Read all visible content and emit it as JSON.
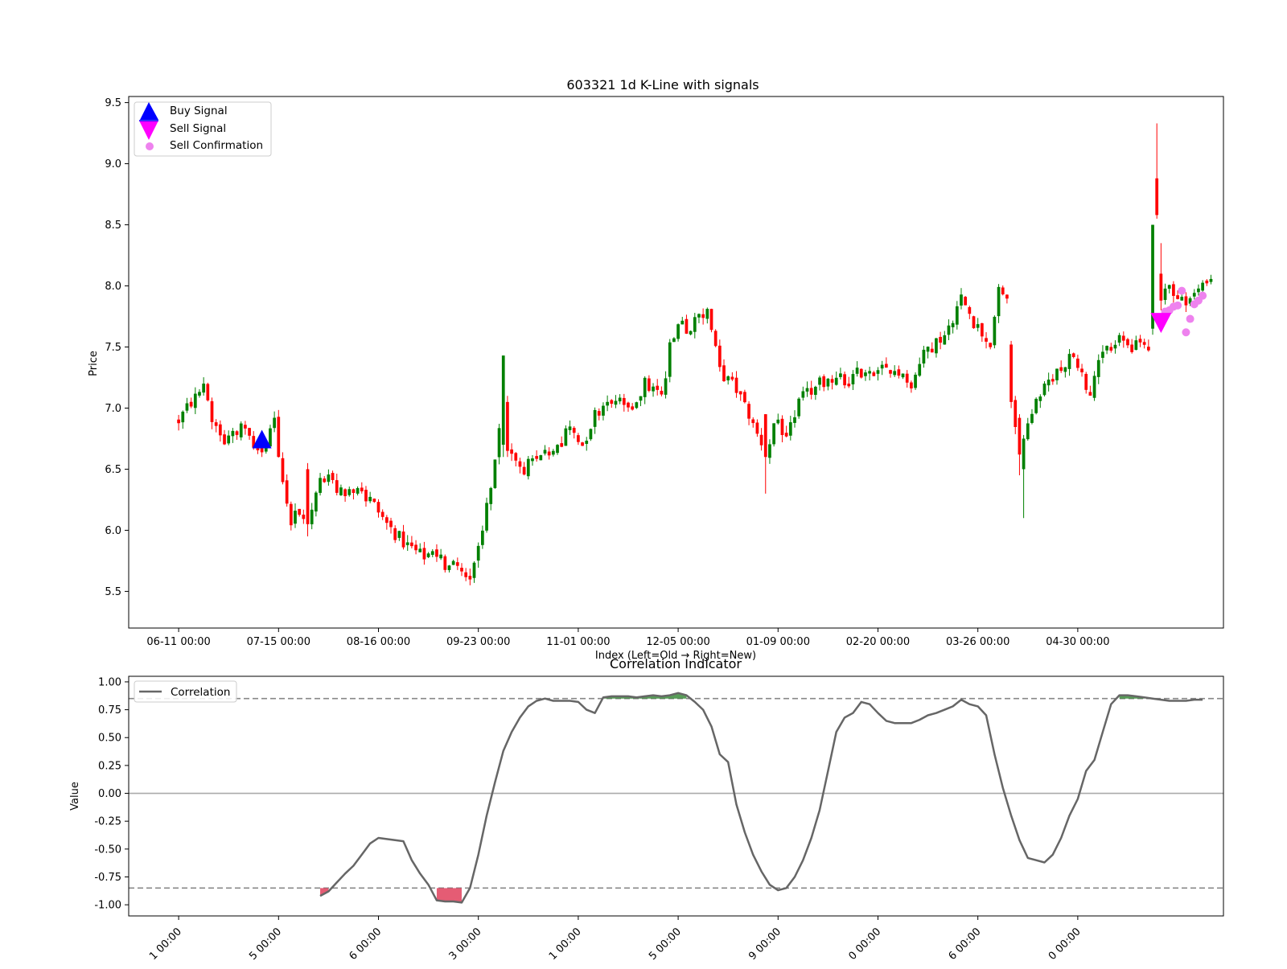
{
  "figure": {
    "background": "#ffffff"
  },
  "chart_data": [
    {
      "type": "candlestick",
      "title": "603321 1d K-Line with signals",
      "xlabel": "Index (Left=Old → Right=New)",
      "ylabel": "Price",
      "ylim": [
        5.2,
        9.55
      ],
      "yticks": [
        "5.5",
        "6.0",
        "6.5",
        "7.0",
        "7.5",
        "8.0",
        "8.5",
        "9.0",
        "9.5"
      ],
      "xticks": [
        {
          "index": 0,
          "label": "06-11 00:00"
        },
        {
          "index": 24,
          "label": "07-15 00:00"
        },
        {
          "index": 48,
          "label": "08-16 00:00"
        },
        {
          "index": 72,
          "label": "09-23 00:00"
        },
        {
          "index": 96,
          "label": "11-01 00:00"
        },
        {
          "index": 120,
          "label": "12-05 00:00"
        },
        {
          "index": 144,
          "label": "01-09 00:00"
        },
        {
          "index": 168,
          "label": "02-20 00:00"
        },
        {
          "index": 192,
          "label": "03-26 00:00"
        },
        {
          "index": 216,
          "label": "04-30 00:00"
        }
      ],
      "x_range": [
        -12,
        251
      ],
      "colors": {
        "up": "#008000",
        "down": "#ff0000"
      },
      "anchors": [
        [
          0,
          6.9
        ],
        [
          3,
          7.05
        ],
        [
          6,
          7.15
        ],
        [
          8,
          6.9
        ],
        [
          11,
          6.75
        ],
        [
          15,
          6.9
        ],
        [
          17,
          6.75
        ],
        [
          19,
          6.6
        ],
        [
          21,
          6.65
        ],
        [
          23,
          6.9
        ],
        [
          25,
          6.4
        ],
        [
          27,
          6.1
        ],
        [
          29,
          6.15
        ],
        [
          31,
          6.0
        ],
        [
          34,
          6.45
        ],
        [
          38,
          6.35
        ],
        [
          42,
          6.3
        ],
        [
          46,
          6.25
        ],
        [
          50,
          6.05
        ],
        [
          54,
          5.9
        ],
        [
          58,
          5.8
        ],
        [
          62,
          5.75
        ],
        [
          66,
          5.7
        ],
        [
          70,
          5.65
        ],
        [
          73,
          6.0
        ],
        [
          76,
          6.6
        ],
        [
          78,
          7.0
        ],
        [
          79,
          6.65
        ],
        [
          82,
          6.5
        ],
        [
          86,
          6.55
        ],
        [
          90,
          6.7
        ],
        [
          94,
          6.85
        ],
        [
          97,
          6.7
        ],
        [
          100,
          6.95
        ],
        [
          104,
          7.1
        ],
        [
          108,
          6.95
        ],
        [
          112,
          7.2
        ],
        [
          116,
          7.1
        ],
        [
          118,
          7.5
        ],
        [
          120,
          7.7
        ],
        [
          123,
          7.65
        ],
        [
          127,
          7.8
        ],
        [
          130,
          7.3
        ],
        [
          134,
          7.15
        ],
        [
          137,
          6.95
        ],
        [
          141,
          6.65
        ],
        [
          143,
          6.85
        ],
        [
          146,
          6.75
        ],
        [
          149,
          7.05
        ],
        [
          152,
          7.15
        ],
        [
          156,
          7.25
        ],
        [
          160,
          7.2
        ],
        [
          164,
          7.3
        ],
        [
          168,
          7.25
        ],
        [
          172,
          7.35
        ],
        [
          176,
          7.2
        ],
        [
          180,
          7.5
        ],
        [
          184,
          7.6
        ],
        [
          188,
          7.9
        ],
        [
          192,
          7.65
        ],
        [
          195,
          7.55
        ],
        [
          197,
          7.95
        ],
        [
          199,
          7.9
        ],
        [
          200,
          7.05
        ],
        [
          202,
          6.7
        ],
        [
          204,
          6.9
        ],
        [
          207,
          7.1
        ],
        [
          211,
          7.3
        ],
        [
          215,
          7.45
        ],
        [
          217,
          7.3
        ],
        [
          219,
          7.1
        ],
        [
          222,
          7.45
        ],
        [
          226,
          7.55
        ],
        [
          230,
          7.5
        ],
        [
          233,
          7.55
        ],
        [
          234,
          8.4
        ],
        [
          235,
          8.7
        ],
        [
          236,
          8.0
        ],
        [
          240,
          7.9
        ],
        [
          244,
          7.9
        ],
        [
          248,
          8.05
        ]
      ],
      "candles": [
        {
          "i": 31,
          "o": 6.5,
          "c": 6.05,
          "h": 6.55,
          "l": 5.95
        },
        {
          "i": 78,
          "o": 6.7,
          "c": 7.43,
          "h": 7.43,
          "l": 6.6
        },
        {
          "i": 79,
          "o": 7.05,
          "c": 6.65,
          "h": 7.1,
          "l": 6.6
        },
        {
          "i": 141,
          "o": 6.95,
          "c": 6.6,
          "h": 6.95,
          "l": 6.3
        },
        {
          "i": 200,
          "o": 7.52,
          "c": 7.05,
          "h": 7.55,
          "l": 7.0
        },
        {
          "i": 202,
          "o": 6.92,
          "c": 6.62,
          "h": 6.95,
          "l": 6.45
        },
        {
          "i": 203,
          "o": 6.5,
          "c": 6.75,
          "h": 6.78,
          "l": 6.1
        },
        {
          "i": 234,
          "o": 7.65,
          "c": 8.5,
          "h": 8.5,
          "l": 7.6
        },
        {
          "i": 235,
          "o": 8.88,
          "c": 8.58,
          "h": 9.33,
          "l": 8.55
        },
        {
          "i": 236,
          "o": 8.1,
          "c": 7.88,
          "h": 8.35,
          "l": 7.8
        }
      ],
      "signals": {
        "buy": [
          {
            "i": 20,
            "price": 6.73,
            "color": "#0000ff"
          }
        ],
        "sell": [
          {
            "i": 236,
            "price": 7.7,
            "color": "#ff00ff"
          }
        ],
        "sell_confirmation": {
          "color": "#ee82ee",
          "points": [
            [
              238,
              7.8
            ],
            [
              239,
              7.83
            ],
            [
              240,
              7.84
            ],
            [
              241,
              7.96
            ],
            [
              242,
              7.62
            ],
            [
              243,
              7.73
            ],
            [
              244,
              7.85
            ],
            [
              245,
              7.88
            ],
            [
              246,
              7.92
            ],
            [
              237,
              7.79
            ]
          ]
        }
      },
      "legend": {
        "position": "upper-left",
        "entries": [
          {
            "label": "Buy Signal",
            "marker": "triangle-up",
            "color": "#0000ff"
          },
          {
            "label": "Sell Signal",
            "marker": "triangle-down",
            "color": "#ff00ff"
          },
          {
            "label": "Sell Confirmation",
            "marker": "circle",
            "color": "#ee82ee"
          }
        ]
      }
    },
    {
      "type": "line",
      "title": "Correlation Indicator",
      "xlabel": "",
      "ylabel": "Value",
      "ylim": [
        -1.1,
        1.05
      ],
      "yticks": [
        "-1.00",
        "-0.75",
        "-0.50",
        "-0.25",
        "0.00",
        "0.25",
        "0.50",
        "0.75",
        "1.00"
      ],
      "xticks": [
        "1 00:00",
        "5 00:00",
        "6 00:00",
        "3 00:00",
        "1 00:00",
        "5 00:00",
        "9 00:00",
        "0 00:00",
        "6 00:00",
        "0 00:00"
      ],
      "x_range": [
        -12,
        251
      ],
      "thresholds": [
        0.85,
        -0.85
      ],
      "zero_line": 0.0,
      "series": [
        {
          "name": "Correlation",
          "color": "#666666",
          "start_index": 34,
          "x": [
            34,
            36,
            38,
            40,
            42,
            44,
            46,
            48,
            50,
            52,
            54,
            56,
            58,
            60,
            62,
            64,
            66,
            68,
            70,
            72,
            74,
            76,
            78,
            80,
            82,
            84,
            86,
            88,
            90,
            92,
            94,
            96,
            98,
            100,
            102,
            104,
            106,
            108,
            110,
            112,
            114,
            116,
            118,
            120,
            122,
            124,
            126,
            128,
            130,
            132,
            134,
            136,
            138,
            140,
            142,
            144,
            146,
            148,
            150,
            152,
            154,
            156,
            158,
            160,
            162,
            164,
            166,
            168,
            170,
            172,
            174,
            176,
            178,
            180,
            182,
            184,
            186,
            188,
            190,
            192,
            194,
            196,
            198,
            200,
            202,
            204,
            206,
            208,
            210,
            212,
            214,
            216,
            218,
            220,
            222,
            224,
            226,
            228,
            230,
            232,
            234,
            236,
            238,
            240,
            242,
            244,
            246
          ],
          "y": [
            -0.92,
            -0.88,
            -0.8,
            -0.72,
            -0.65,
            -0.55,
            -0.45,
            -0.4,
            -0.41,
            -0.42,
            -0.43,
            -0.6,
            -0.72,
            -0.82,
            -0.96,
            -0.97,
            -0.97,
            -0.98,
            -0.85,
            -0.55,
            -0.2,
            0.1,
            0.38,
            0.55,
            0.68,
            0.78,
            0.83,
            0.85,
            0.83,
            0.83,
            0.83,
            0.82,
            0.75,
            0.72,
            0.86,
            0.87,
            0.87,
            0.87,
            0.86,
            0.87,
            0.88,
            0.87,
            0.88,
            0.9,
            0.88,
            0.82,
            0.75,
            0.6,
            0.35,
            0.28,
            -0.1,
            -0.35,
            -0.55,
            -0.7,
            -0.82,
            -0.87,
            -0.85,
            -0.75,
            -0.6,
            -0.4,
            -0.15,
            0.2,
            0.55,
            0.68,
            0.72,
            0.82,
            0.8,
            0.72,
            0.65,
            0.63,
            0.63,
            0.63,
            0.66,
            0.7,
            0.72,
            0.75,
            0.78,
            0.84,
            0.8,
            0.78,
            0.7,
            0.35,
            0.05,
            -0.2,
            -0.42,
            -0.58,
            -0.6,
            -0.62,
            -0.55,
            -0.4,
            -0.2,
            -0.05,
            0.2,
            0.3,
            0.55,
            0.8,
            0.88,
            0.88,
            0.87,
            0.86,
            0.85,
            0.84,
            0.83,
            0.83,
            0.83,
            0.84,
            0.84
          ]
        }
      ],
      "fills": {
        "above_color": "#3c8c3c",
        "below_color": "#e0405c"
      },
      "legend": {
        "position": "upper-left",
        "entries": [
          {
            "label": "Correlation",
            "color": "#666666"
          }
        ]
      }
    }
  ]
}
